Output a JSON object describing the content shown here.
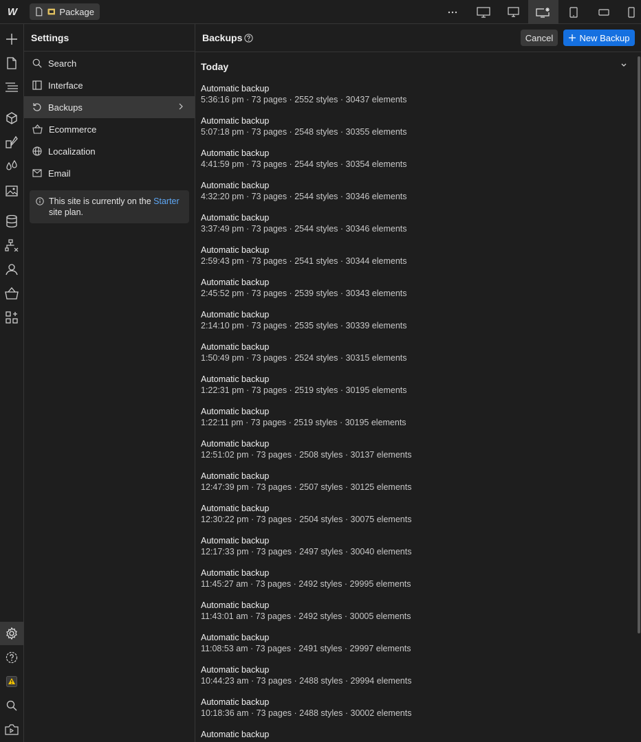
{
  "topbar": {
    "logo": "W",
    "page_label": "Package"
  },
  "settings": {
    "title": "Settings",
    "items": [
      {
        "label": "Search",
        "icon": "search-icon"
      },
      {
        "label": "Interface",
        "icon": "interface-icon"
      },
      {
        "label": "Backups",
        "icon": "backup-icon",
        "active": true
      },
      {
        "label": "Ecommerce",
        "icon": "basket-icon"
      },
      {
        "label": "Localization",
        "icon": "globe-icon"
      },
      {
        "label": "Email",
        "icon": "mail-icon"
      }
    ],
    "plan": {
      "text_before": "This site is currently on the ",
      "link": "Starter",
      "text_after": " site plan."
    }
  },
  "main": {
    "title": "Backups",
    "cancel_label": "Cancel",
    "new_label": "New Backup",
    "section": "Today",
    "backups": [
      {
        "title": "Automatic backup",
        "meta": "5:36:16 pm · 73 pages · 2552 styles · 30437 elements"
      },
      {
        "title": "Automatic backup",
        "meta": "5:07:18 pm · 73 pages · 2548 styles · 30355 elements"
      },
      {
        "title": "Automatic backup",
        "meta": "4:41:59 pm · 73 pages · 2544 styles · 30354 elements"
      },
      {
        "title": "Automatic backup",
        "meta": "4:32:20 pm · 73 pages · 2544 styles · 30346 elements"
      },
      {
        "title": "Automatic backup",
        "meta": "3:37:49 pm · 73 pages · 2544 styles · 30346 elements"
      },
      {
        "title": "Automatic backup",
        "meta": "2:59:43 pm · 73 pages · 2541 styles · 30344 elements"
      },
      {
        "title": "Automatic backup",
        "meta": "2:45:52 pm · 73 pages · 2539 styles · 30343 elements"
      },
      {
        "title": "Automatic backup",
        "meta": "2:14:10 pm · 73 pages · 2535 styles · 30339 elements"
      },
      {
        "title": "Automatic backup",
        "meta": "1:50:49 pm · 73 pages · 2524 styles · 30315 elements"
      },
      {
        "title": "Automatic backup",
        "meta": "1:22:31 pm · 73 pages · 2519 styles · 30195 elements"
      },
      {
        "title": "Automatic backup",
        "meta": "1:22:11 pm · 73 pages · 2519 styles · 30195 elements"
      },
      {
        "title": "Automatic backup",
        "meta": "12:51:02 pm · 73 pages · 2508 styles · 30137 elements"
      },
      {
        "title": "Automatic backup",
        "meta": "12:47:39 pm · 73 pages · 2507 styles · 30125 elements"
      },
      {
        "title": "Automatic backup",
        "meta": "12:30:22 pm · 73 pages · 2504 styles · 30075 elements"
      },
      {
        "title": "Automatic backup",
        "meta": "12:17:33 pm · 73 pages · 2497 styles · 30040 elements"
      },
      {
        "title": "Automatic backup",
        "meta": "11:45:27 am · 73 pages · 2492 styles · 29995 elements"
      },
      {
        "title": "Automatic backup",
        "meta": "11:43:01 am · 73 pages · 2492 styles · 30005 elements"
      },
      {
        "title": "Automatic backup",
        "meta": "11:08:53 am · 73 pages · 2491 styles · 29997 elements"
      },
      {
        "title": "Automatic backup",
        "meta": "10:44:23 am · 73 pages · 2488 styles · 29994 elements"
      },
      {
        "title": "Automatic backup",
        "meta": "10:18:36 am · 73 pages · 2488 styles · 30002 elements"
      },
      {
        "title": "Automatic backup",
        "meta": ""
      }
    ]
  },
  "colors": {
    "accent": "#1570e0",
    "link": "#5ea7f5",
    "warning": "#f5c400"
  }
}
